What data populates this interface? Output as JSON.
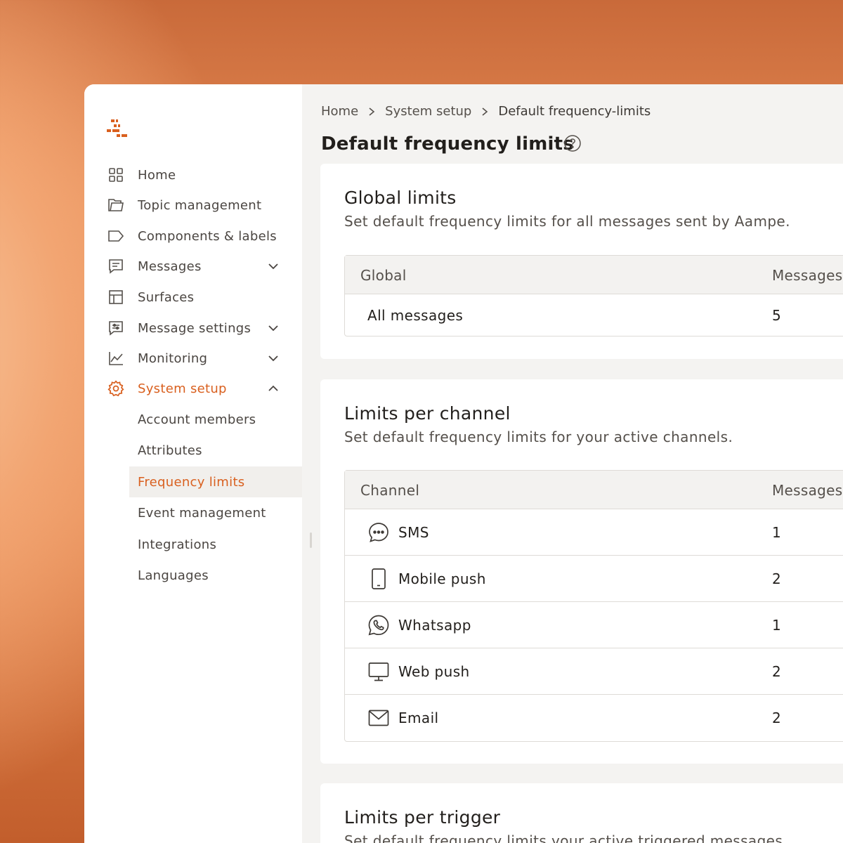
{
  "sidebar": {
    "items": [
      {
        "label": "Home",
        "icon": "grid-icon"
      },
      {
        "label": "Topic management",
        "icon": "folder-icon"
      },
      {
        "label": "Components & labels",
        "icon": "tag-icon"
      },
      {
        "label": "Messages",
        "icon": "message-icon"
      },
      {
        "label": "Surfaces",
        "icon": "layout-icon"
      },
      {
        "label": "Message settings",
        "icon": "message-settings-icon"
      },
      {
        "label": "Monitoring",
        "icon": "chart-icon"
      },
      {
        "label": "System setup",
        "icon": "gear-icon"
      }
    ],
    "sub_items": [
      {
        "label": "Account members"
      },
      {
        "label": "Attributes"
      },
      {
        "label": "Frequency limits"
      },
      {
        "label": "Event management"
      },
      {
        "label": "Integrations"
      },
      {
        "label": "Languages"
      }
    ]
  },
  "breadcrumb": [
    "Home",
    "System setup",
    "Default frequency-limits"
  ],
  "page": {
    "title": "Default frequency limits"
  },
  "global": {
    "title": "Global limits",
    "subtitle": "Set default frequency limits for all messages sent by Aampe.",
    "headers": [
      "Global",
      "Messages"
    ],
    "rows": [
      {
        "name": "All messages",
        "value": "5"
      }
    ]
  },
  "channel": {
    "title": "Limits per channel",
    "subtitle": "Set default frequency limits for your active channels.",
    "headers": [
      "Channel",
      "Messages"
    ],
    "rows": [
      {
        "name": "SMS",
        "value": "1",
        "icon": "sms-bubble-icon"
      },
      {
        "name": "Mobile push",
        "value": "2",
        "icon": "mobile-phone-icon"
      },
      {
        "name": "Whatsapp",
        "value": "1",
        "icon": "whatsapp-icon"
      },
      {
        "name": "Web push",
        "value": "2",
        "icon": "monitor-icon"
      },
      {
        "name": "Email",
        "value": "2",
        "icon": "envelope-icon"
      }
    ]
  },
  "trigger": {
    "title": "Limits per trigger",
    "subtitle": "Set default frequency limits your active triggered messages."
  },
  "colors": {
    "accent": "#d9601f",
    "text": "#221f1c",
    "muted": "#55504b"
  }
}
